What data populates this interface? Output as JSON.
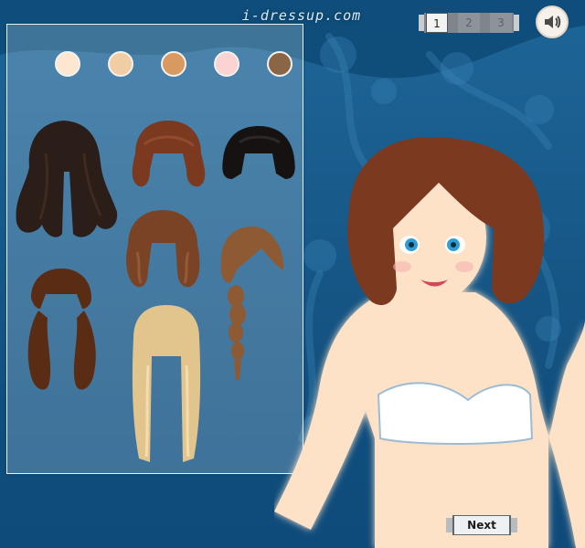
{
  "site": {
    "title": "i-dressup.com"
  },
  "pages": [
    {
      "label": "1",
      "active": true
    },
    {
      "label": "2",
      "active": false
    },
    {
      "label": "3",
      "active": false
    }
  ],
  "sound": {
    "icon": "speaker-icon"
  },
  "skin_tones": [
    "#fde7d1",
    "#f1cda6",
    "#d99a62",
    "#fbd3d2",
    "#8a6647"
  ],
  "hair_styles": [
    {
      "name": "long-wavy-black",
      "color": "#2b1d17"
    },
    {
      "name": "short-bob-brown",
      "color": "#7b3a1f"
    },
    {
      "name": "bob-bangs-black",
      "color": "#161212"
    },
    {
      "name": "medium-wavy-brown",
      "color": "#7a4326"
    },
    {
      "name": "side-braid-brown",
      "color": "#8d5a33"
    },
    {
      "name": "pigtails-brown",
      "color": "#5a2c14"
    },
    {
      "name": "long-blonde-bangs",
      "color": "#e2c48d"
    }
  ],
  "navigation": {
    "next_label": "Next"
  }
}
